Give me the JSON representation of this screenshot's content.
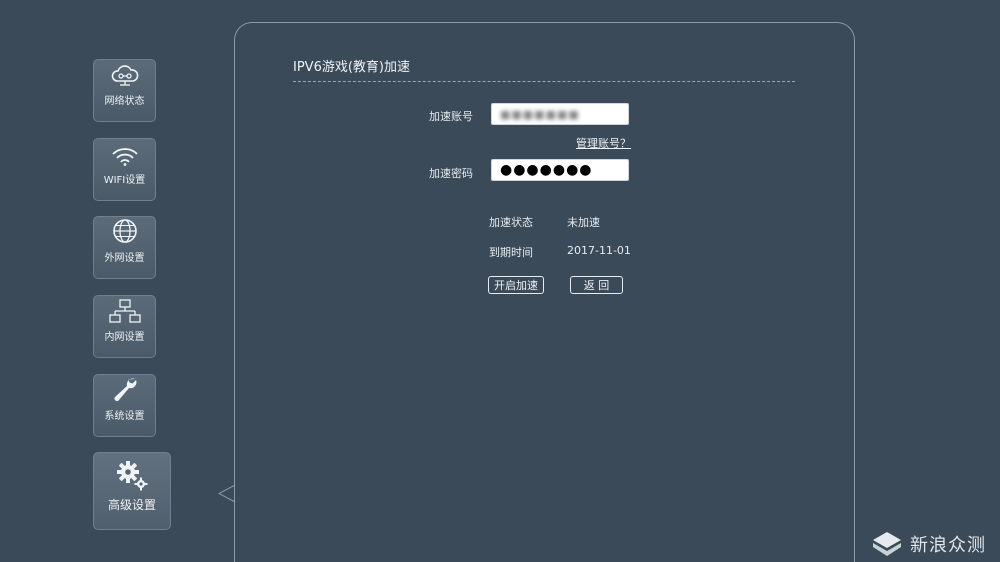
{
  "sidebar": {
    "items": [
      {
        "label": "网络状态",
        "icon": "cloud-network-icon"
      },
      {
        "label": "WIFI设置",
        "icon": "wifi-icon"
      },
      {
        "label": "外网设置",
        "icon": "globe-icon"
      },
      {
        "label": "内网设置",
        "icon": "lan-topology-icon"
      },
      {
        "label": "系统设置",
        "icon": "wrench-icon"
      },
      {
        "label": "高级设置",
        "icon": "gears-icon"
      }
    ],
    "active_index": 5
  },
  "panel": {
    "title": "IPV6游戏(教育)加速",
    "account_label": "加速账号",
    "account_value": "■■■■■■■",
    "manage_link": "管理账号？",
    "password_label": "加速密码",
    "password_value": "●●●●●●●",
    "status_label": "加速状态",
    "status_value": "未加速",
    "expiry_label": "到期时间",
    "expiry_value": "2017-11-01",
    "start_button": "开启加速",
    "back_button": "返 回"
  },
  "watermark": {
    "text": "新浪众测",
    "icon": "sina-logo-icon"
  },
  "colors": {
    "background": "#3a4a58",
    "border": "#8d9aa5",
    "text": "#e9eef2"
  }
}
